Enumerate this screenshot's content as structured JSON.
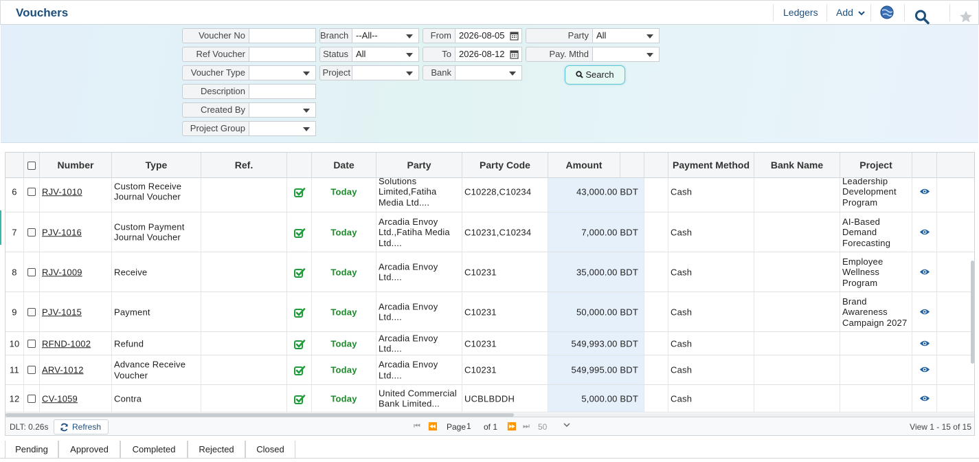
{
  "header": {
    "title": "Vouchers",
    "ledgers_label": "Ledgers",
    "add_label": "Add"
  },
  "filters": {
    "voucher_no": {
      "label": "Voucher No",
      "value": ""
    },
    "ref_voucher": {
      "label": "Ref Voucher",
      "value": ""
    },
    "voucher_type": {
      "label": "Voucher Type",
      "value": ""
    },
    "description": {
      "label": "Description",
      "value": ""
    },
    "created_by": {
      "label": "Created By",
      "value": ""
    },
    "project_group": {
      "label": "Project Group",
      "value": ""
    },
    "branch": {
      "label": "Branch",
      "value": "--All--"
    },
    "status": {
      "label": "Status",
      "value": "All"
    },
    "project": {
      "label": "Project",
      "value": ""
    },
    "from": {
      "label": "From",
      "value": "2026-08-05"
    },
    "to": {
      "label": "To",
      "value": "2026-08-12"
    },
    "bank": {
      "label": "Bank",
      "value": ""
    },
    "party": {
      "label": "Party",
      "value": "All"
    },
    "pay_mthd": {
      "label": "Pay. Mthd",
      "value": ""
    },
    "search_label": "Search"
  },
  "grid": {
    "columns": {
      "number": "Number",
      "type": "Type",
      "ref": "Ref.",
      "date": "Date",
      "party": "Party",
      "party_code": "Party Code",
      "amount": "Amount",
      "payment_method": "Payment Method",
      "bank_name": "Bank Name",
      "project": "Project"
    },
    "rows": [
      {
        "rn": "6",
        "number": "RJV-1010",
        "type": "Custom Receive Journal Voucher",
        "ref": "",
        "date": "Today",
        "party": "Solutions Limited,Fatiha Media Ltd....",
        "party_code": "C10228,C10234",
        "amount": "43,000.00 BDT",
        "payment_method": "Cash",
        "bank_name": "",
        "project": "Leadership Development Program"
      },
      {
        "rn": "7",
        "number": "PJV-1016",
        "type": "Custom Payment Journal Voucher",
        "ref": "",
        "date": "Today",
        "party": "Arcadia Envoy Ltd.,Fatiha Media Ltd....",
        "party_code": "C10231,C10234",
        "amount": "7,000.00 BDT",
        "payment_method": "Cash",
        "bank_name": "",
        "project": "AI-Based Demand Forecasting"
      },
      {
        "rn": "8",
        "number": "RJV-1009",
        "type": "Receive",
        "ref": "",
        "date": "Today",
        "party": "Arcadia Envoy Ltd....",
        "party_code": "C10231",
        "amount": "35,000.00 BDT",
        "payment_method": "Cash",
        "bank_name": "",
        "project": "Employee Wellness Program"
      },
      {
        "rn": "9",
        "number": "PJV-1015",
        "type": "Payment",
        "ref": "",
        "date": "Today",
        "party": "Arcadia Envoy Ltd....",
        "party_code": "C10231",
        "amount": "50,000.00 BDT",
        "payment_method": "Cash",
        "bank_name": "",
        "project": "Brand Awareness Campaign 2027"
      },
      {
        "rn": "10",
        "number": "RFND-1002",
        "type": "Refund",
        "ref": "",
        "date": "Today",
        "party": "Arcadia Envoy Ltd....",
        "party_code": "C10231",
        "amount": "549,993.00 BDT",
        "payment_method": "Cash",
        "bank_name": "",
        "project": ""
      },
      {
        "rn": "11",
        "number": "ARV-1012",
        "type": "Advance Receive Voucher",
        "ref": "",
        "date": "Today",
        "party": "Arcadia Envoy Ltd....",
        "party_code": "C10231",
        "amount": "549,995.00 BDT",
        "payment_method": "Cash",
        "bank_name": "",
        "project": ""
      },
      {
        "rn": "12",
        "number": "CV-1059",
        "type": "Contra",
        "ref": "",
        "date": "Today",
        "party": "United Commercial Bank Limited...",
        "party_code": "UCBLBDDH",
        "amount": "5,000.00 BDT",
        "payment_method": "Cash",
        "bank_name": "",
        "project": ""
      }
    ]
  },
  "pager": {
    "dlt": "DLT: 0.26s",
    "refresh_label": "Refresh",
    "page_label": "Page",
    "page_value": "1",
    "of_label": "of 1",
    "page_size": "50",
    "view_text": "View 1 - 15 of 15"
  },
  "status_tabs": [
    "Pending",
    "Approved",
    "Completed",
    "Rejected",
    "Closed"
  ],
  "colors": {
    "accent": "#1d4f7e",
    "date_green": "#1e8a2c",
    "amount_bg": "#e5f0fa",
    "eye": "#1d5fa0"
  }
}
